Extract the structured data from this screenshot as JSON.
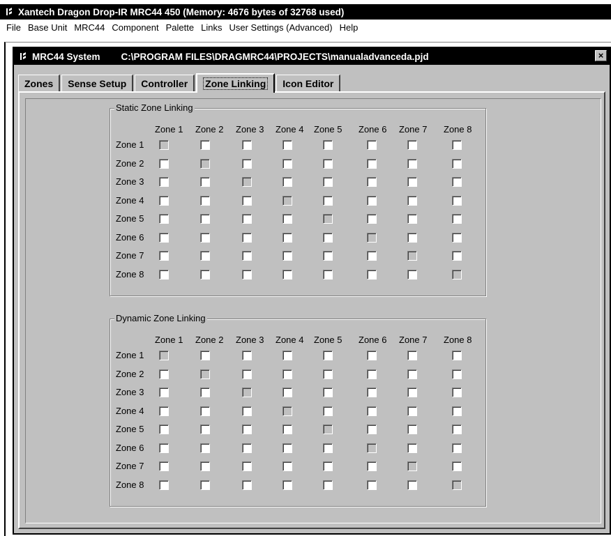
{
  "app": {
    "title": "Xantech Dragon Drop-IR MRC44 450 (Memory: 4676 bytes of 32768 used)"
  },
  "menu": [
    "File",
    "Base Unit",
    "MRC44",
    "Component",
    "Palette",
    "Links",
    "User Settings (Advanced)",
    "Help"
  ],
  "child_window": {
    "title_app": "MRC44 System",
    "title_path": "C:\\PROGRAM FILES\\DRAGMRC44\\PROJECTS\\manualadvanceda.pjd",
    "close_label": "×"
  },
  "tabs": [
    {
      "label": "Zones",
      "active": false
    },
    {
      "label": "Sense Setup",
      "active": false
    },
    {
      "label": "Controller",
      "active": false
    },
    {
      "label": "Zone Linking",
      "active": true
    },
    {
      "label": "Icon Editor",
      "active": false
    }
  ],
  "zones": [
    "Zone 1",
    "Zone 2",
    "Zone 3",
    "Zone 4",
    "Zone 5",
    "Zone 6",
    "Zone 7",
    "Zone 8"
  ],
  "groups": [
    {
      "title": "Static Zone Linking"
    },
    {
      "title": "Dynamic Zone Linking"
    }
  ]
}
